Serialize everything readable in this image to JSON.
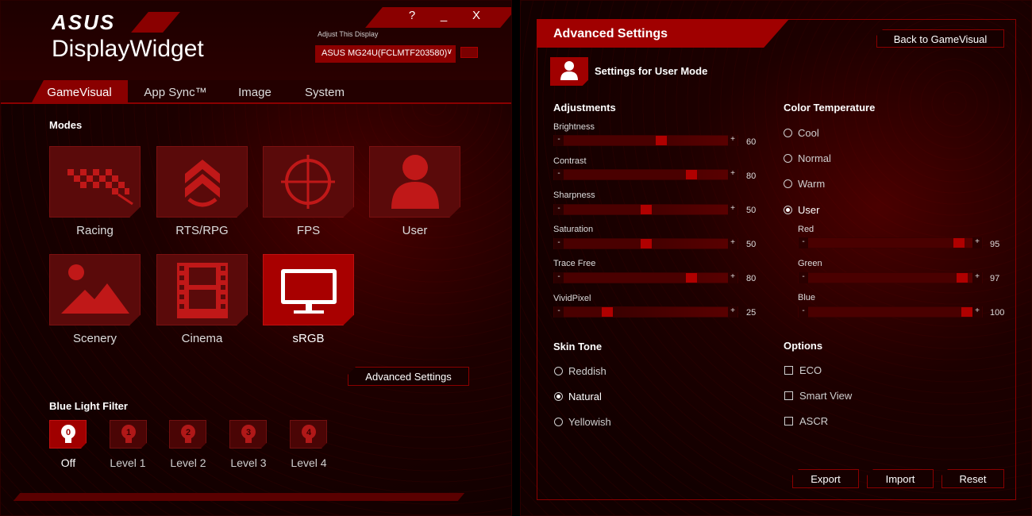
{
  "left": {
    "brand": "ASUS",
    "app_title": "DisplayWidget",
    "titlebar": {
      "help": "?",
      "minimize": "_",
      "close": "X"
    },
    "display": {
      "label": "Adjust This Display",
      "selected": "ASUS MG24U(FCLMTF203580)"
    },
    "tabs": [
      "GameVisual",
      "App Sync™",
      "Image",
      "System"
    ],
    "active_tab": "GameVisual",
    "modes": {
      "title": "Modes",
      "items": [
        {
          "label": "Racing",
          "icon": "racing-flag-icon"
        },
        {
          "label": "RTS/RPG",
          "icon": "rank-chevron-icon"
        },
        {
          "label": "FPS",
          "icon": "crosshair-icon"
        },
        {
          "label": "User",
          "icon": "user-icon"
        },
        {
          "label": "Scenery",
          "icon": "landscape-icon"
        },
        {
          "label": "Cinema",
          "icon": "film-icon"
        },
        {
          "label": "sRGB",
          "icon": "monitor-icon"
        }
      ],
      "selected": "sRGB"
    },
    "advanced_button": "Advanced Settings",
    "blue_light": {
      "title": "Blue Light Filter",
      "levels": [
        {
          "num": "0",
          "label": "Off"
        },
        {
          "num": "1",
          "label": "Level 1"
        },
        {
          "num": "2",
          "label": "Level 2"
        },
        {
          "num": "3",
          "label": "Level 3"
        },
        {
          "num": "4",
          "label": "Level 4"
        }
      ],
      "selected": "Off"
    }
  },
  "right": {
    "title": "Advanced Settings",
    "back_button": "Back to GameVisual",
    "settings_title": "Settings for User Mode",
    "adjustments": {
      "title": "Adjustments",
      "sliders": [
        {
          "label": "Brightness",
          "value": 60
        },
        {
          "label": "Contrast",
          "value": 80
        },
        {
          "label": "Sharpness",
          "value": 50
        },
        {
          "label": "Saturation",
          "value": 50
        },
        {
          "label": "Trace Free",
          "value": 80
        },
        {
          "label": "VividPixel",
          "value": 25
        }
      ]
    },
    "color_temp": {
      "title": "Color Temperature",
      "options": [
        "Cool",
        "Normal",
        "Warm",
        "User"
      ],
      "selected": "User",
      "rgb": [
        {
          "label": "Red",
          "value": 95
        },
        {
          "label": "Green",
          "value": 97
        },
        {
          "label": "Blue",
          "value": 100
        }
      ]
    },
    "skin_tone": {
      "title": "Skin Tone",
      "options": [
        "Reddish",
        "Natural",
        "Yellowish"
      ],
      "selected": "Natural"
    },
    "options": {
      "title": "Options",
      "items": [
        {
          "label": "ECO",
          "checked": false
        },
        {
          "label": "Smart View",
          "checked": false
        },
        {
          "label": "ASCR",
          "checked": false
        }
      ]
    },
    "buttons": {
      "export": "Export",
      "import": "Import",
      "reset": "Reset"
    }
  },
  "colors": {
    "accent": "#a00000",
    "background": "#120000",
    "text": "#dddddd"
  }
}
